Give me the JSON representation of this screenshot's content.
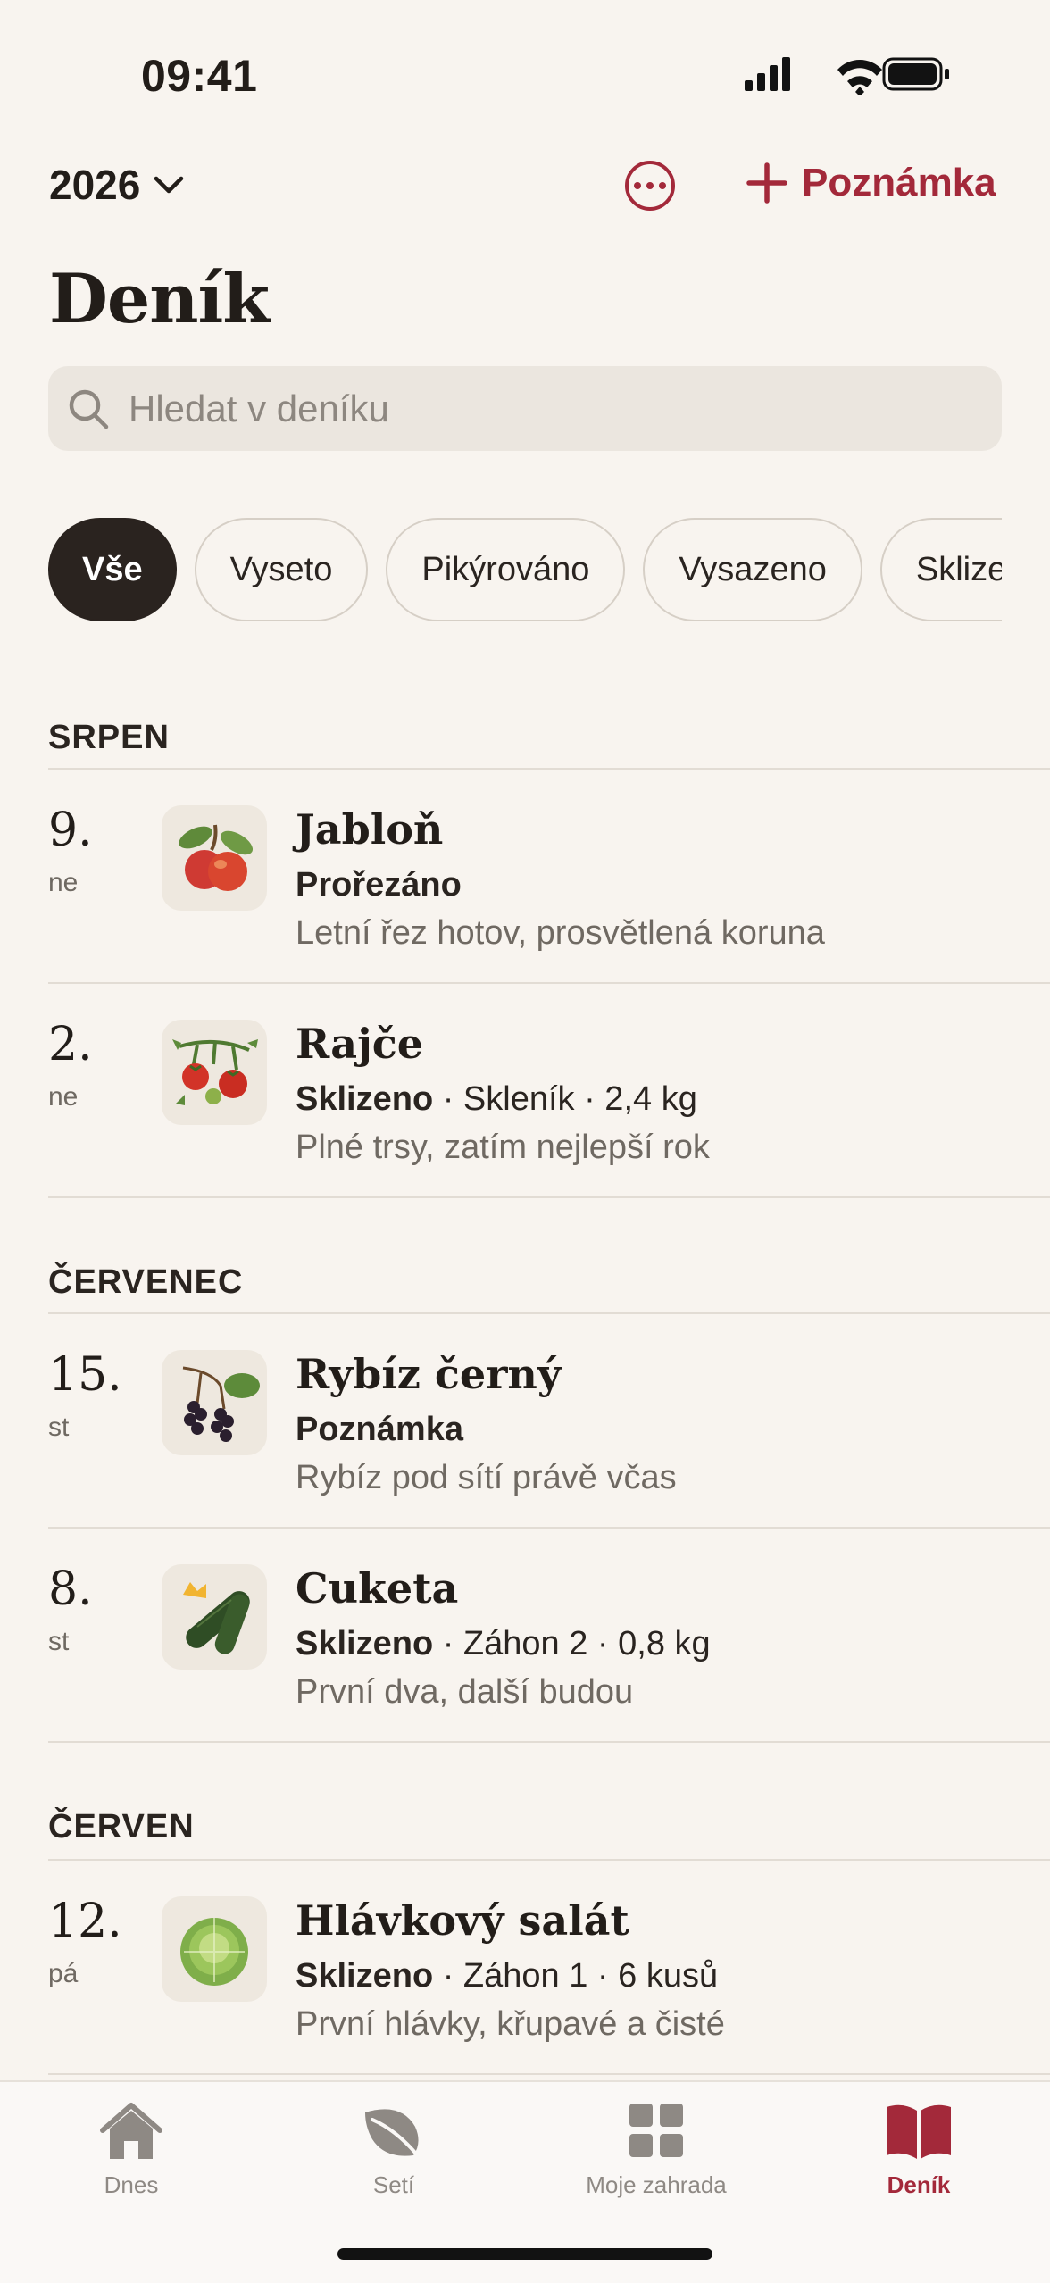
{
  "status_bar": {
    "time": "09:41"
  },
  "header": {
    "year": "2026",
    "add_note_label": "Poznámka",
    "title": "Deník"
  },
  "search": {
    "placeholder": "Hledat v deníku"
  },
  "filters": [
    "Vše",
    "Vyseto",
    "Pikýrováno",
    "Vysazeno",
    "Sklizeno"
  ],
  "sections": [
    {
      "label": "SRPEN",
      "entries": [
        {
          "day": "9.",
          "weekday": "ne",
          "plant": "Jabloň",
          "action": "Prořezáno",
          "details": "",
          "note": "Letní řez hotov, prosvětlená koruna",
          "icon": "apple-icon"
        },
        {
          "day": "2.",
          "weekday": "ne",
          "plant": "Rajče",
          "action": "Sklizeno",
          "details": " · Skleník · 2,4 kg",
          "note": "Plné trsy, zatím nejlepší rok",
          "icon": "tomato-icon"
        }
      ]
    },
    {
      "label": "ČERVENEC",
      "entries": [
        {
          "day": "15.",
          "weekday": "st",
          "plant": "Rybíz černý",
          "action": "Poznámka",
          "details": "",
          "note": "Rybíz pod sítí právě včas",
          "icon": "blackcurrant-icon"
        },
        {
          "day": "8.",
          "weekday": "st",
          "plant": "Cuketa",
          "action": "Sklizeno",
          "details": " · Záhon 2 · 0,8 kg",
          "note": "První dva, další budou",
          "icon": "zucchini-icon"
        }
      ]
    },
    {
      "label": "ČERVEN",
      "entries": [
        {
          "day": "12.",
          "weekday": "pá",
          "plant": "Hlávkový salát",
          "action": "Sklizeno",
          "details": " · Záhon 1 · 6 kusů",
          "note": "První hlávky, křupavé a čisté",
          "icon": "lettuce-icon"
        }
      ]
    }
  ],
  "tabbar": {
    "items": [
      {
        "label": "Dnes",
        "icon": "home-icon"
      },
      {
        "label": "Setí",
        "icon": "leaf-icon"
      },
      {
        "label": "Moje zahrada",
        "icon": "grid-icon"
      },
      {
        "label": "Deník",
        "icon": "book-icon"
      }
    ],
    "active": "Deník"
  },
  "colors": {
    "accent": "#a3293a",
    "background": "#f8f4ef",
    "chip_active": "#2a231f"
  }
}
